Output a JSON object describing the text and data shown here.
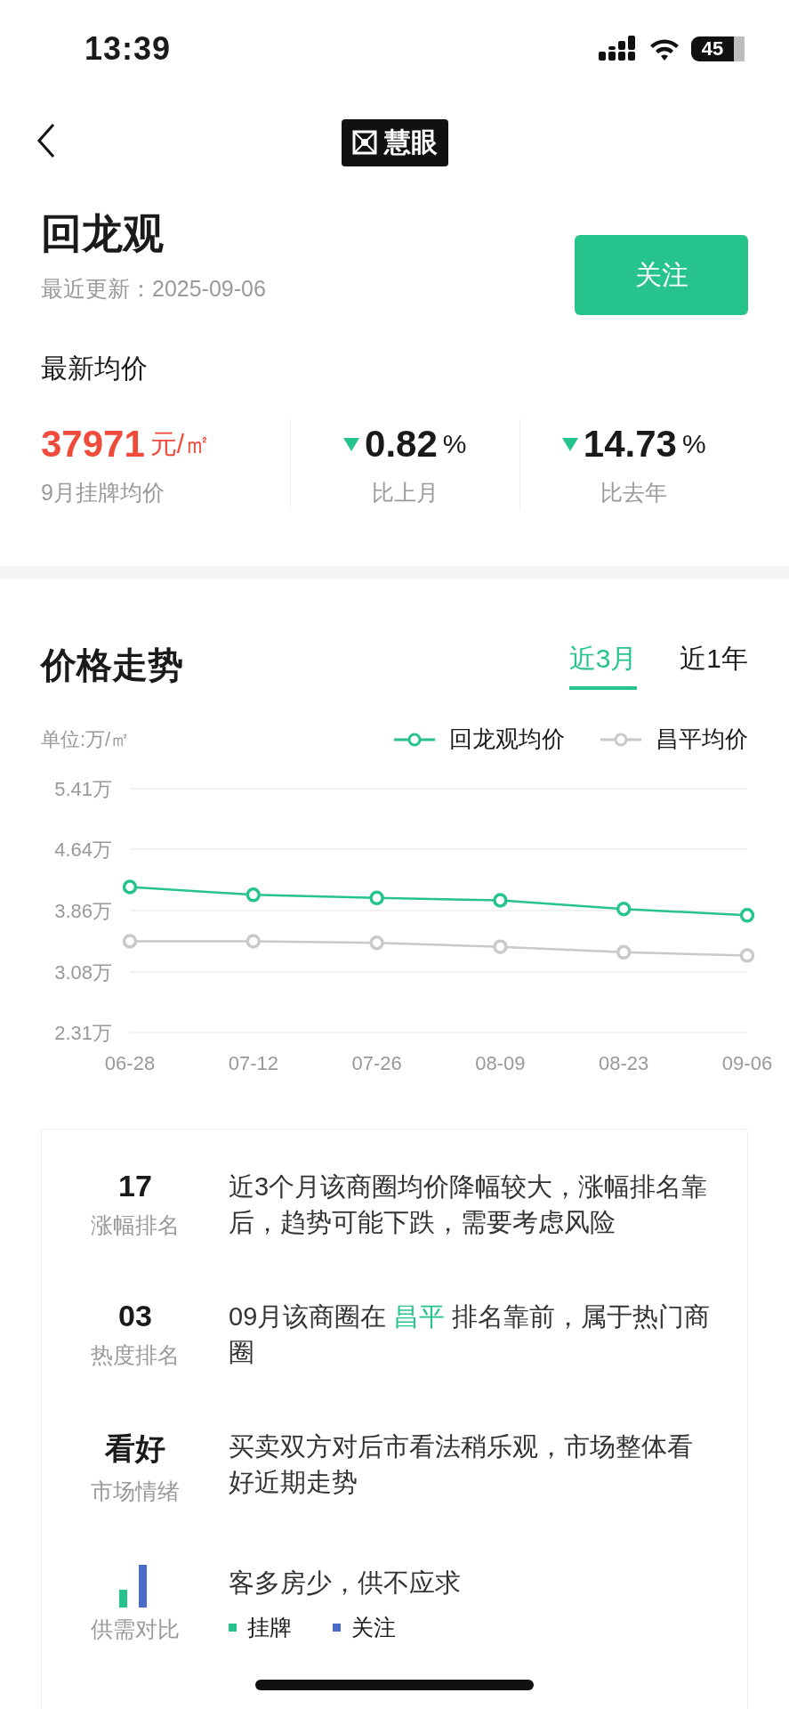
{
  "status_bar": {
    "time": "13:39",
    "battery": "45"
  },
  "nav": {
    "logo": "慧眼"
  },
  "header": {
    "title": "回龙观",
    "updated": "最近更新：2025-09-06",
    "follow_button": "关注"
  },
  "latest_price": {
    "heading": "最新均价",
    "stats": [
      {
        "kind": "price",
        "value": "37971",
        "unit": "元/㎡",
        "label": "9月挂牌均价"
      },
      {
        "kind": "change",
        "falling": true,
        "value": "0.82",
        "unit": "%",
        "label": "比上月"
      },
      {
        "kind": "change",
        "falling": true,
        "value": "14.73",
        "unit": "%",
        "label": "比去年"
      }
    ]
  },
  "trend": {
    "heading": "价格走势",
    "tabs": [
      {
        "label": "近3月",
        "selected": true
      },
      {
        "label": "近1年",
        "selected": false
      }
    ],
    "unit": "单位:万/㎡",
    "chart_data": {
      "type": "line",
      "categories": [
        "06-28",
        "07-12",
        "07-26",
        "08-09",
        "08-23",
        "09-06"
      ],
      "grid": true,
      "series": [
        {
          "name": "回龙观均价",
          "color": "#26c48c",
          "marker": "circle",
          "values": [
            4.16,
            4.06,
            4.02,
            3.99,
            3.88,
            3.8
          ]
        },
        {
          "name": "昌平均价",
          "color": "#c8c9cc",
          "marker": "circle",
          "values": [
            3.47,
            3.47,
            3.45,
            3.4,
            3.33,
            3.29
          ]
        }
      ],
      "ylim": [
        2.31,
        5.41
      ],
      "yticks": [
        {
          "value": 5.41,
          "label": "5.41万"
        },
        {
          "value": 4.64,
          "label": "4.64万"
        },
        {
          "value": 3.86,
          "label": "3.86万"
        },
        {
          "value": 3.08,
          "label": "3.08万"
        },
        {
          "value": 2.31,
          "label": "2.31万"
        }
      ]
    }
  },
  "insights": [
    {
      "kind": "text",
      "value": "17",
      "label": "涨幅排名",
      "segments": [
        {
          "text": "近3个月该商圈均价降幅较大，涨幅排名靠后，趋势可能下跌，需要考虑风险",
          "highlight": false
        }
      ]
    },
    {
      "kind": "text",
      "value": "03",
      "label": "热度排名",
      "segments": [
        {
          "text": "09月该商圈在 ",
          "highlight": false
        },
        {
          "text": "昌平",
          "highlight": true
        },
        {
          "text": " 排名靠前，属于热门商圈",
          "highlight": false
        }
      ]
    },
    {
      "kind": "text",
      "value": "看好",
      "label": "市场情绪",
      "segments": [
        {
          "text": "买卖双方对后市看法稍乐观，市场整体看好近期走势",
          "highlight": false
        }
      ]
    },
    {
      "kind": "supply",
      "label": "供需对比",
      "segments": [
        {
          "text": "客多房少，供不应求",
          "highlight": false
        }
      ],
      "legend": [
        {
          "label": "挂牌",
          "color": "#26c48c"
        },
        {
          "label": "关注",
          "color": "#4a6bc6"
        }
      ]
    }
  ]
}
